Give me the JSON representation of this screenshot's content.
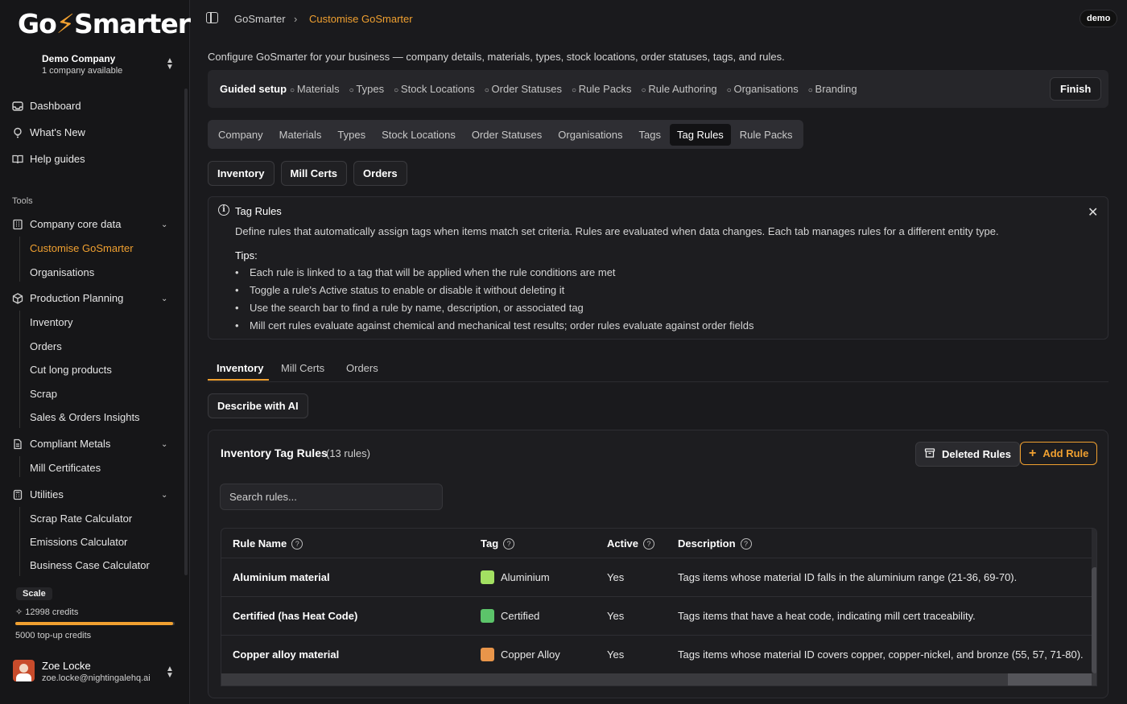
{
  "sidebar": {
    "logo": {
      "part1": "Go",
      "bolt": "⚡",
      "part2": "Smarter"
    },
    "company": {
      "name": "Demo Company",
      "sub": "1 company available"
    },
    "nav": [
      {
        "label": "Dashboard",
        "icon": "inbox-icon"
      },
      {
        "label": "What's New",
        "icon": "lightbulb-icon"
      },
      {
        "label": "Help guides",
        "icon": "book-icon"
      }
    ],
    "tools_label": "Tools",
    "groups": {
      "company_core": {
        "label": "Company core data",
        "items": [
          "Customise GoSmarter",
          "Organisations"
        ]
      },
      "production": {
        "label": "Production Planning",
        "items": [
          "Inventory",
          "Orders",
          "Cut long products",
          "Scrap",
          "Sales & Orders Insights"
        ]
      },
      "compliant": {
        "label": "Compliant Metals",
        "items": [
          "Mill Certificates"
        ]
      },
      "utilities": {
        "label": "Utilities",
        "items": [
          "Scrap Rate Calculator",
          "Emissions Calculator",
          "Business Case Calculator"
        ]
      }
    },
    "plan": "Scale",
    "credits": "12998 credits",
    "credits_fraction": 0.99,
    "topup": "5000 top-up credits",
    "user": {
      "name": "Zoe Locke",
      "email": "zoe.locke@nightingalehq.ai"
    }
  },
  "topbar": {
    "crumb_root": "GoSmarter",
    "crumb_sep": "›",
    "crumb_current": "Customise GoSmarter",
    "env": "demo"
  },
  "intro": "Configure GoSmarter for your business — company details, materials, types, stock locations, order statuses, tags, and rules.",
  "guided": {
    "title": "Guided setup",
    "steps": [
      "Materials",
      "Types",
      "Stock Locations",
      "Order Statuses",
      "Rule Packs",
      "Rule Authoring",
      "Organisations",
      "Branding"
    ],
    "finish": "Finish"
  },
  "tabs": [
    "Company",
    "Materials",
    "Types",
    "Stock Locations",
    "Order Statuses",
    "Organisations",
    "Tags",
    "Tag Rules",
    "Rule Packs"
  ],
  "active_tab": "Tag Rules",
  "sub_buttons": [
    "Inventory",
    "Mill Certs",
    "Orders"
  ],
  "info": {
    "title": "Tag Rules",
    "desc": "Define rules that automatically assign tags when items match set criteria. Rules are evaluated when data changes. Each tab manages rules for a different entity type.",
    "tips_label": "Tips:",
    "tips": [
      "Each rule is linked to a tag that will be applied when the rule conditions are met",
      "Toggle a rule's Active status to enable or disable it without deleting it",
      "Use the search bar to find a rule by name, description, or associated tag",
      "Mill cert rules evaluate against chemical and mechanical test results; order rules evaluate against order fields"
    ]
  },
  "entity_tabs": [
    "Inventory",
    "Mill Certs",
    "Orders"
  ],
  "ai_button": "Describe with AI",
  "card": {
    "title": "Inventory Tag Rules",
    "count": "(13 rules)",
    "deleted_btn": "Deleted Rules",
    "add_btn": "Add Rule",
    "search_placeholder": "Search rules...",
    "columns": [
      "Rule Name",
      "Tag",
      "Active",
      "Description"
    ],
    "rows": [
      {
        "name": "Aluminium material",
        "tag": "Aluminium",
        "color": "#a3e062",
        "active": "Yes",
        "description": "Tags items whose material ID falls in the aluminium range (21-36, 69-70)."
      },
      {
        "name": "Certified (has Heat Code)",
        "tag": "Certified",
        "color": "#5cc46a",
        "active": "Yes",
        "description": "Tags items that have a heat code, indicating mill cert traceability."
      },
      {
        "name": "Copper alloy material",
        "tag": "Copper Alloy",
        "color": "#e8954a",
        "active": "Yes",
        "description": "Tags items whose material ID covers copper, copper-nickel, and bronze (55, 57, 71-80)."
      }
    ]
  }
}
